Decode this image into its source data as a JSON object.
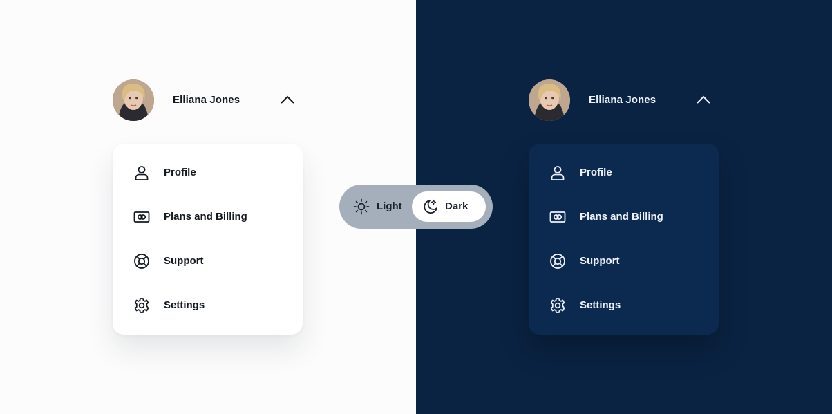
{
  "theme_toggle": {
    "light_label": "Light",
    "dark_label": "Dark",
    "light_icon": "sun-icon",
    "dark_icon": "moon-stars-icon",
    "selected": "Dark"
  },
  "panels": [
    {
      "theme": "light",
      "user": {
        "name": "Elliana Jones",
        "avatar": "user-avatar"
      },
      "menu": [
        {
          "label": "Profile",
          "icon": "user-icon"
        },
        {
          "label": "Plans and Billing",
          "icon": "billing-card-icon"
        },
        {
          "label": "Support",
          "icon": "lifebuoy-icon"
        },
        {
          "label": "Settings",
          "icon": "gear-icon"
        }
      ],
      "colors": {
        "background": "#fcfcfc",
        "card": "#ffffff",
        "text": "#151a22"
      }
    },
    {
      "theme": "dark",
      "user": {
        "name": "Elliana Jones",
        "avatar": "user-avatar"
      },
      "menu": [
        {
          "label": "Profile",
          "icon": "user-icon"
        },
        {
          "label": "Plans and Billing",
          "icon": "billing-card-icon"
        },
        {
          "label": "Support",
          "icon": "lifebuoy-icon"
        },
        {
          "label": "Settings",
          "icon": "gear-icon"
        }
      ],
      "colors": {
        "background": "#0a2343",
        "card": "#0c2a50",
        "text": "#eef2f8"
      }
    }
  ]
}
